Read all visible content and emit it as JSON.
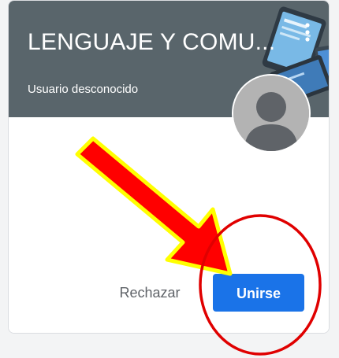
{
  "card": {
    "title": "LENGUAJE Y COMU...",
    "owner": "Usuario desconocido",
    "banner_color": "#59656b",
    "avatar_icon": "person-placeholder-icon",
    "menu_icon": "more-vert-icon"
  },
  "actions": {
    "reject_label": "Rechazar",
    "join_label": "Unirse",
    "join_color": "#1a73e8"
  },
  "annotation": {
    "arrow_color": "#ff0000",
    "arrow_outline": "#ffff00",
    "circle_color": "#e00000"
  }
}
